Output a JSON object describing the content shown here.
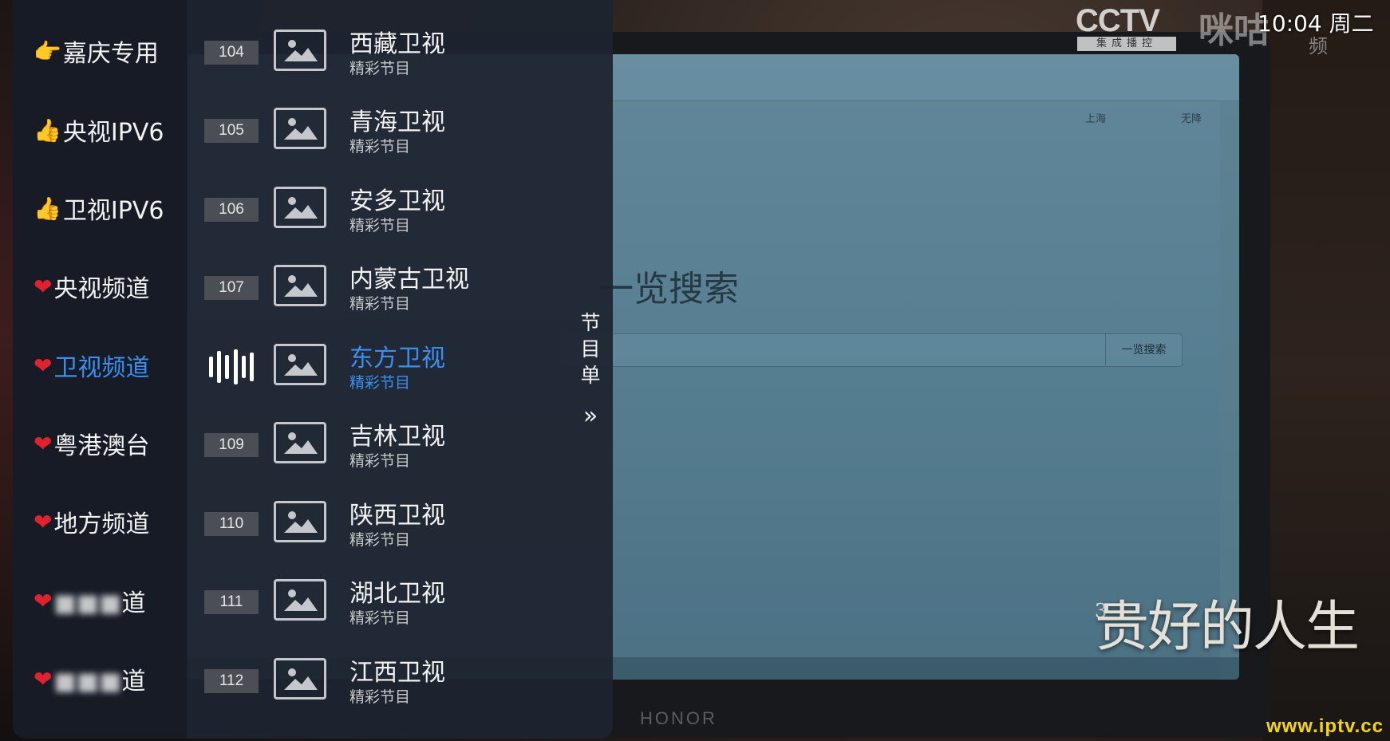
{
  "overlay": {
    "clock": "10:04 周二",
    "cctv_logo": "CCTV",
    "cctv_sub": "集成播控",
    "migu_logo": "咪咕",
    "migu_sub": "频",
    "show_title": "贵好的人生",
    "show_title_num": "3",
    "watermark": "www.iptv.cc"
  },
  "background_screen": {
    "search_title": "一览搜索",
    "search_button": "一览搜索",
    "weather_city": "上海",
    "weather_desc": "无降",
    "laptop_brand": "HONOR"
  },
  "categories": [
    {
      "emoji": "👉",
      "emoji_type": "pointer",
      "label": "嘉庆专用",
      "blurred": false
    },
    {
      "emoji": "👍",
      "emoji_type": "thumb",
      "label": "央视IPV6",
      "blurred": false
    },
    {
      "emoji": "👍",
      "emoji_type": "thumb",
      "label": "卫视IPV6",
      "blurred": false
    },
    {
      "emoji": "❤",
      "emoji_type": "heart",
      "label": "央视频道",
      "blurred": false
    },
    {
      "emoji": "❤",
      "emoji_type": "heart",
      "label": "卫视频道",
      "blurred": false,
      "active": true
    },
    {
      "emoji": "❤",
      "emoji_type": "heart",
      "label": "粤港澳台",
      "blurred": false
    },
    {
      "emoji": "❤",
      "emoji_type": "heart",
      "label": "地方频道",
      "blurred": false
    },
    {
      "emoji": "❤",
      "emoji_type": "heart",
      "label": "道",
      "blurred": true
    },
    {
      "emoji": "❤",
      "emoji_type": "heart",
      "label": "道",
      "blurred": true
    }
  ],
  "channels": [
    {
      "number": "104",
      "name": "西藏卫视",
      "program": "精彩节目"
    },
    {
      "number": "105",
      "name": "青海卫视",
      "program": "精彩节目"
    },
    {
      "number": "106",
      "name": "安多卫视",
      "program": "精彩节目"
    },
    {
      "number": "107",
      "name": "内蒙古卫视",
      "program": "精彩节目"
    },
    {
      "number": "",
      "name": "东方卫视",
      "program": "精彩节目",
      "playing": true
    },
    {
      "number": "109",
      "name": "吉林卫视",
      "program": "精彩节目"
    },
    {
      "number": "110",
      "name": "陕西卫视",
      "program": "精彩节目"
    },
    {
      "number": "111",
      "name": "湖北卫视",
      "program": "精彩节目"
    },
    {
      "number": "112",
      "name": "江西卫视",
      "program": "精彩节目"
    }
  ],
  "epg": {
    "label": "节目单",
    "arrow_icon": "double-chevron-right-icon"
  },
  "colors": {
    "active": "#3a8ff0",
    "heart": "#e0212e",
    "watermark": "#f5d800"
  }
}
